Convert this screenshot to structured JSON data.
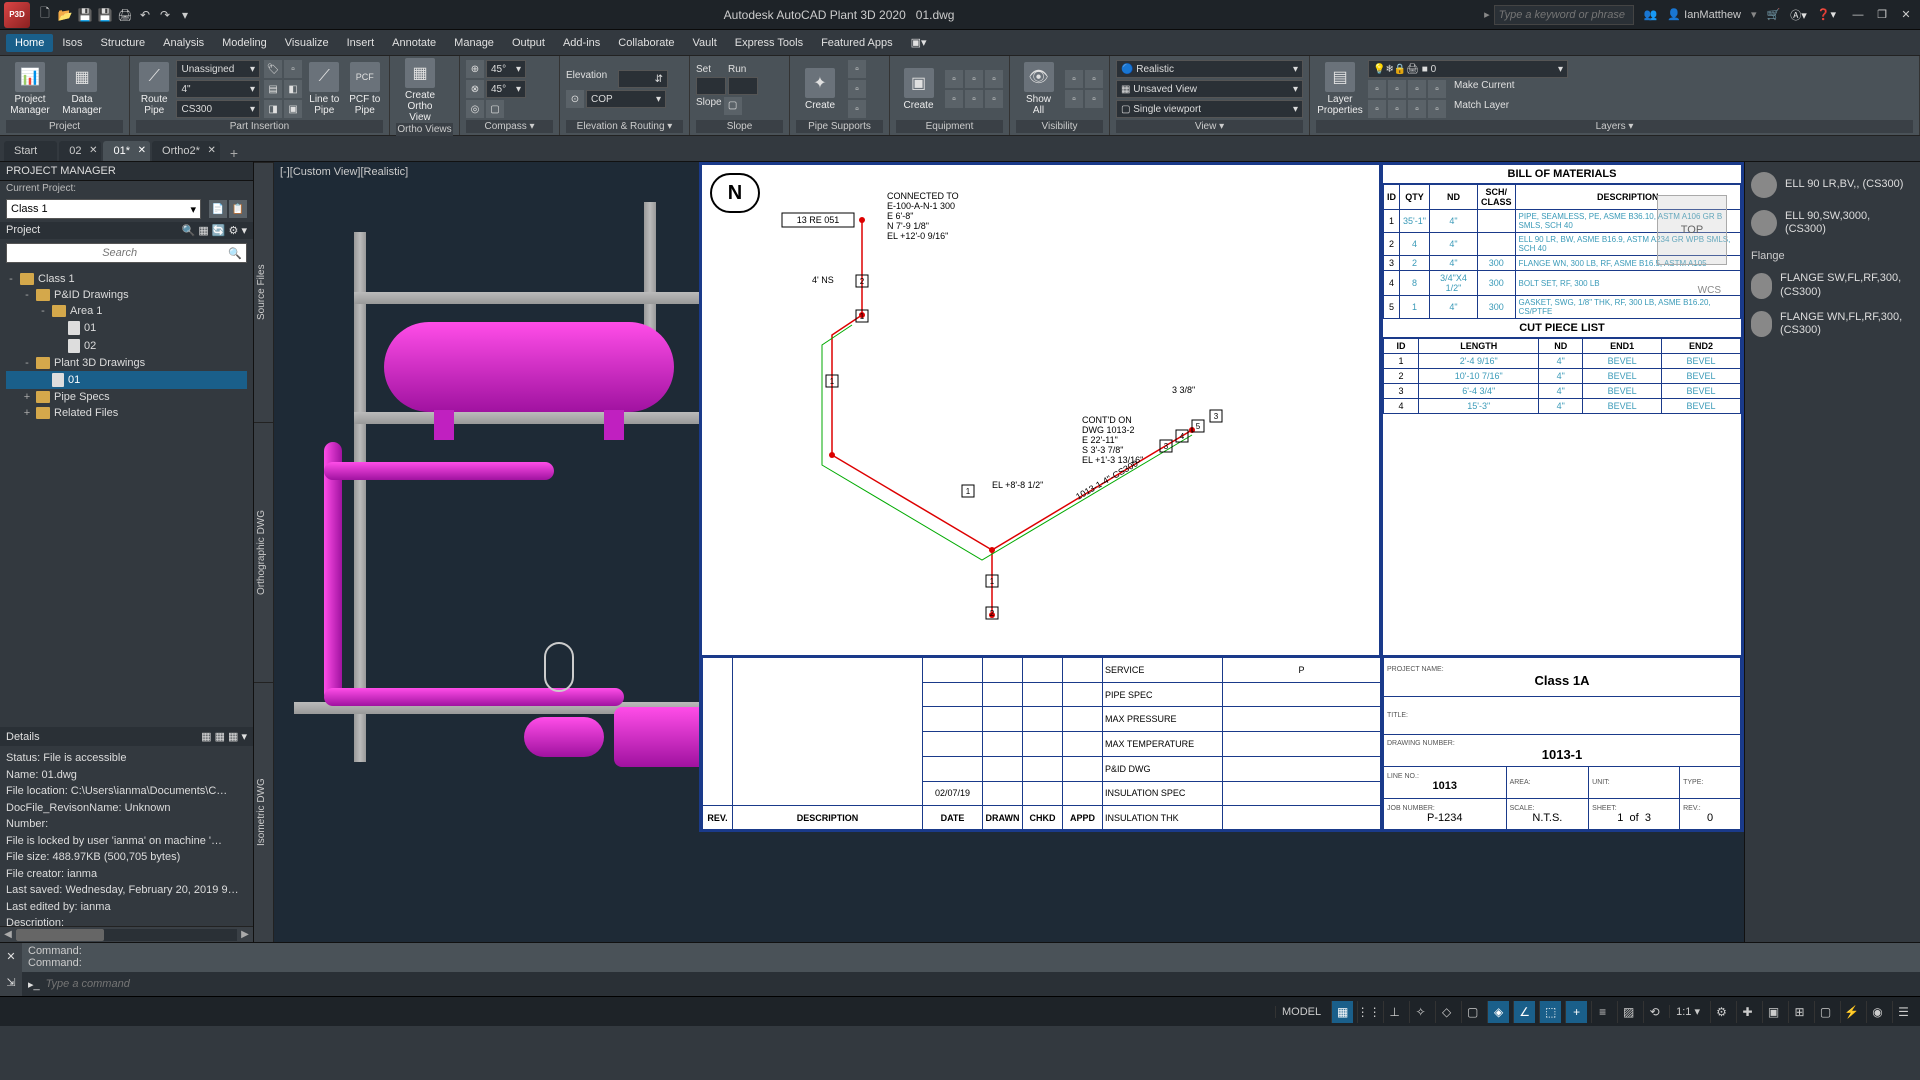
{
  "app": {
    "title": "Autodesk AutoCAD Plant 3D 2020",
    "file": "01.dwg"
  },
  "search_placeholder": "Type a keyword or phrase",
  "user": "IanMatthew",
  "menus": [
    "Home",
    "Isos",
    "Structure",
    "Analysis",
    "Modeling",
    "Visualize",
    "Insert",
    "Annotate",
    "Manage",
    "Output",
    "Add-ins",
    "Collaborate",
    "Vault",
    "Express Tools",
    "Featured Apps"
  ],
  "ribbon": {
    "project": {
      "mgr_label": "Project\nManager",
      "data_label": "Data\nManager",
      "panel": "Project"
    },
    "route": {
      "label": "Route\nPipe",
      "assign": "Unassigned",
      "size": "4\"",
      "spec": "CS300",
      "panel": "Part Insertion"
    },
    "lineto": {
      "label": "Line to\nPipe",
      "pcf": "PCF to\nPipe",
      "pcf_top": "PCF"
    },
    "ortho": {
      "create": "Create\nOrtho View",
      "panel": "Ortho Views"
    },
    "compass": {
      "a45": "45°",
      "b45": "45°",
      "panel": "Compass"
    },
    "elev": {
      "lbl": "Elevation",
      "cop": "COP",
      "panel": "Elevation & Routing"
    },
    "slope": {
      "set": "Set",
      "run": "Run",
      "lbl": "Slope",
      "panel": "Slope"
    },
    "create": {
      "label": "Create",
      "panel": "Pipe Supports"
    },
    "create2": {
      "label": "Create",
      "panel": "Equipment"
    },
    "show": {
      "label": "Show\nAll",
      "panel": "Visibility"
    },
    "view": {
      "realistic": "Realistic",
      "unsaved": "Unsaved View",
      "single": "Single viewport",
      "panel": "View"
    },
    "layers": {
      "props": "Layer\nProperties",
      "make": "Make Current",
      "match": "Match Layer",
      "num": "0",
      "panel": "Layers"
    }
  },
  "doctabs": [
    {
      "label": "Start",
      "closable": false
    },
    {
      "label": "02",
      "closable": true
    },
    {
      "label": "01*",
      "closable": true,
      "active": true
    },
    {
      "label": "Ortho2*",
      "closable": true
    }
  ],
  "pm": {
    "title": "PROJECT MANAGER",
    "current": "Current Project:",
    "project": "Class 1",
    "section": "Project",
    "search_ph": "Search"
  },
  "tree": [
    {
      "exp": "-",
      "ind": 0,
      "icon": "folder",
      "label": "Class 1"
    },
    {
      "exp": "-",
      "ind": 1,
      "icon": "folder",
      "label": "P&ID Drawings"
    },
    {
      "exp": "-",
      "ind": 2,
      "icon": "folder",
      "label": "Area 1"
    },
    {
      "exp": "",
      "ind": 3,
      "icon": "file",
      "label": "01"
    },
    {
      "exp": "",
      "ind": 3,
      "icon": "file",
      "label": "02"
    },
    {
      "exp": "-",
      "ind": 1,
      "icon": "folder",
      "label": "Plant 3D Drawings"
    },
    {
      "exp": "",
      "ind": 2,
      "icon": "file",
      "label": "01",
      "selected": true
    },
    {
      "exp": "+",
      "ind": 1,
      "icon": "folder",
      "label": "Pipe Specs"
    },
    {
      "exp": "+",
      "ind": 1,
      "icon": "folder",
      "label": "Related Files"
    }
  ],
  "details": {
    "title": "Details",
    "lines": [
      "Status: File is accessible",
      "Name: 01.dwg",
      "File location: C:\\Users\\ianma\\Documents\\C…",
      "DocFile_RevisonName: Unknown",
      "Number:",
      "File is locked by user 'ianma' on machine '…",
      "File size: 488.97KB (500,705 bytes)",
      "File creator: ianma",
      "Last saved: Wednesday, February 20, 2019 9…",
      "Last edited by: ianma",
      "Description:"
    ]
  },
  "side_tabs": [
    "Source Files",
    "Orthographic DWG",
    "Isometric DWG"
  ],
  "vp_label": "[-][Custom View][Realistic]",
  "viewcube": {
    "top": "TOP",
    "wcs": "WCS"
  },
  "iso_annotations": {
    "connected": "CONNECTED TO\nE-100-A-N-1 300\nE 6'-8\"\nN 7'-9 1/8\"\nEL +12'-0 9/16\"",
    "contd": "CONT'D ON\nDWG 1013-2\nE 22'-11\"\nS 3'-3 7/8\"\nEL +1'-3 13/16\"",
    "el": "EL +8'-8 1/2\"",
    "line": "1013-1-4\"-CS300",
    "bop1": "4' NS",
    "dim1": "3 3/8\"",
    "tag": "13 RE 051"
  },
  "bom": {
    "title": "BILL OF MATERIALS",
    "headers": [
      "ID",
      "QTY",
      "ND",
      "SCH/\nCLASS",
      "DESCRIPTION"
    ],
    "rows": [
      {
        "id": "1",
        "qty": "35'-1\"",
        "nd": "4\"",
        "sch": "",
        "desc": "PIPE, SEAMLESS, PE, ASME B36.10, ASTM A106 GR B SMLS, SCH 40"
      },
      {
        "id": "2",
        "qty": "4",
        "nd": "4\"",
        "sch": "",
        "desc": "ELL 90 LR, BW, ASME B16.9, ASTM A234 GR WPB SMLS, SCH 40"
      },
      {
        "id": "3",
        "qty": "2",
        "nd": "4\"",
        "sch": "300",
        "desc": "FLANGE WN, 300 LB, RF, ASME B16.5, ASTM A105"
      },
      {
        "id": "4",
        "qty": "8",
        "nd": "3/4\"X4 1/2\"",
        "sch": "300",
        "desc": "BOLT SET, RF, 300 LB"
      },
      {
        "id": "5",
        "qty": "1",
        "nd": "4\"",
        "sch": "300",
        "desc": "GASKET, SWG, 1/8\" THK, RF, 300 LB, ASME B16.20, CS/PTFE"
      }
    ]
  },
  "cpl": {
    "title": "CUT PIECE LIST",
    "headers": [
      "ID",
      "LENGTH",
      "ND",
      "END1",
      "END2"
    ],
    "rows": [
      {
        "id": "1",
        "len": "2'-4 9/16\"",
        "nd": "4\"",
        "e1": "BEVEL",
        "e2": "BEVEL"
      },
      {
        "id": "2",
        "len": "10'-10 7/16\"",
        "nd": "4\"",
        "e1": "BEVEL",
        "e2": "BEVEL"
      },
      {
        "id": "3",
        "len": "6'-4 3/4\"",
        "nd": "4\"",
        "e1": "BEVEL",
        "e2": "BEVEL"
      },
      {
        "id": "4",
        "len": "15'-3\"",
        "nd": "4\"",
        "e1": "BEVEL",
        "e2": "BEVEL"
      }
    ]
  },
  "tb": {
    "rev_hdr": [
      "REV.",
      "DESCRIPTION",
      "DATE",
      "DRAWN",
      "CHKD",
      "APPD"
    ],
    "date": "02/07/19",
    "fields": [
      "SERVICE",
      "PIPE SPEC",
      "MAX PRESSURE",
      "MAX TEMPERATURE",
      "P&ID DWG",
      "INSULATION SPEC",
      "INSULATION THK"
    ],
    "service_val": "P",
    "proj_name_lbl": "PROJECT NAME:",
    "proj_name": "Class 1A",
    "title_lbl": "TITLE:",
    "dwg_num_lbl": "DRAWING NUMBER:",
    "dwg_num": "1013-1",
    "line_lbl": "LINE NO.:",
    "line": "1013",
    "area_lbl": "AREA:",
    "unit_lbl": "UNIT:",
    "type_lbl": "TYPE:",
    "job_lbl": "JOB NUMBER:",
    "job": "P-1234",
    "scale_lbl": "SCALE:",
    "scale": "N.T.S.",
    "sheet_lbl": "SHEET:",
    "sheet_a": "1",
    "sheet_of": "of",
    "sheet_b": "3",
    "rev_lbl": "REV.:",
    "rev": "0"
  },
  "catalog": {
    "items": [
      {
        "label": "ELL 90 LR,BV,, (CS300)"
      },
      {
        "label": "ELL 90,SW,3000, (CS300)"
      }
    ],
    "section": "Flange",
    "flanges": [
      {
        "label": "FLANGE SW,FL,RF,300, (CS300)"
      },
      {
        "label": "FLANGE WN,FL,RF,300, (CS300)"
      }
    ]
  },
  "cmd": {
    "hist": "Command:\nCommand:",
    "ph": "Type a command"
  },
  "status": {
    "model": "MODEL",
    "scale": "1:1"
  }
}
